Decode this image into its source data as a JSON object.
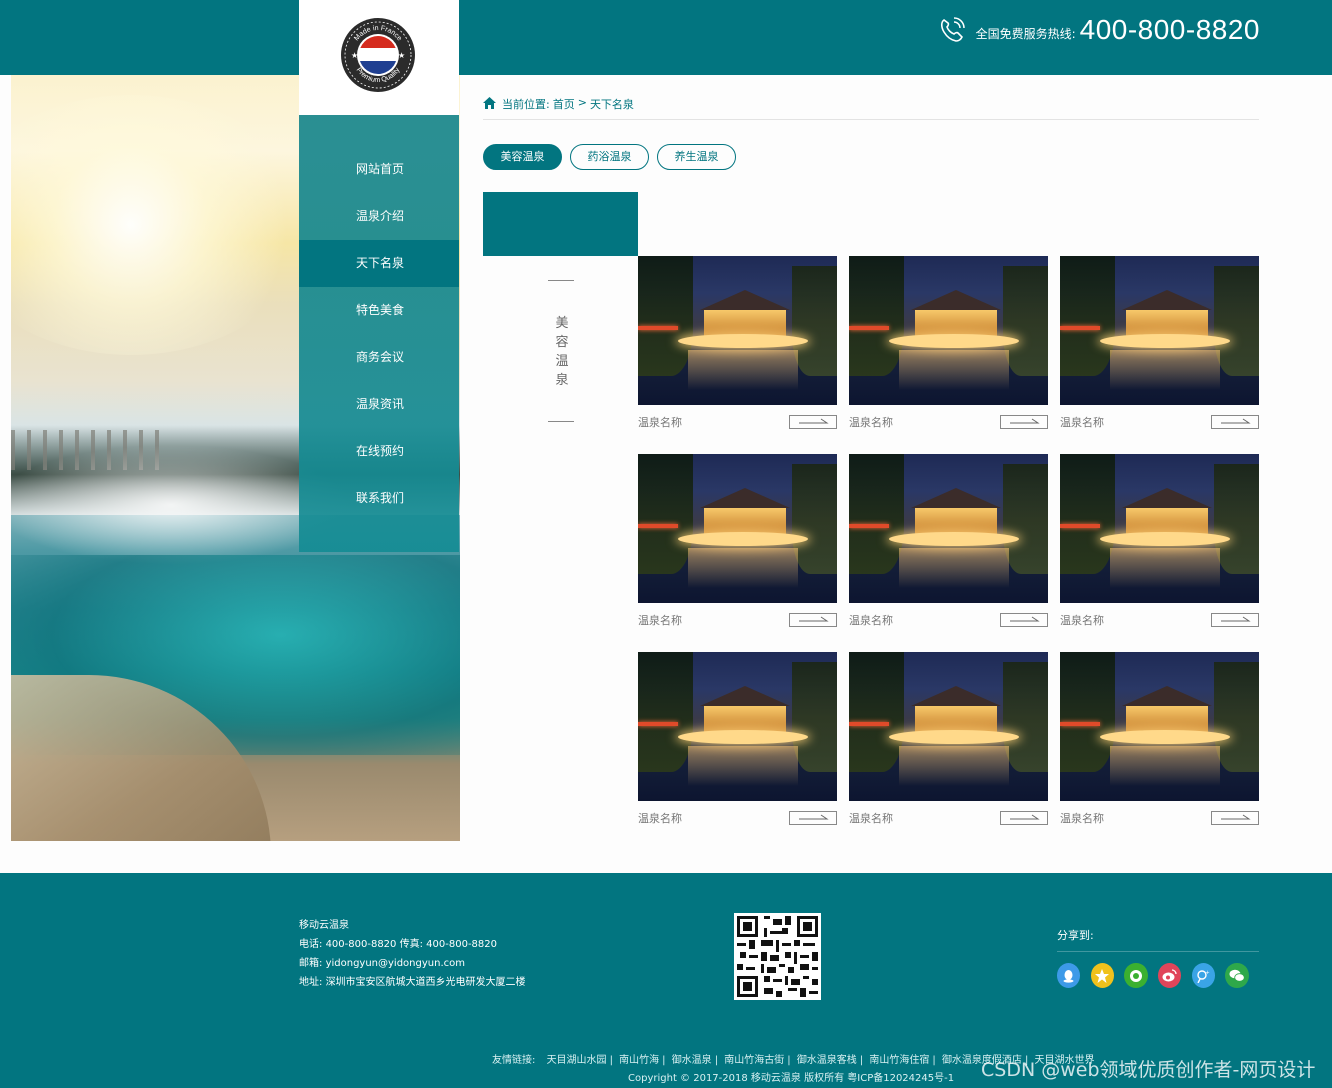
{
  "colors": {
    "brand": "#027580",
    "accent_white": "#ffffff",
    "text_gray": "#777777"
  },
  "header": {
    "hotline_label": "全国免费服务热线:",
    "hotline_number": "400-800-8820",
    "logo_badge_top": "Made in France",
    "logo_badge_bottom": "Premium Quality"
  },
  "nav": {
    "items": [
      {
        "label": "网站首页",
        "active": false
      },
      {
        "label": "温泉介绍",
        "active": false
      },
      {
        "label": "天下名泉",
        "active": true
      },
      {
        "label": "特色美食",
        "active": false
      },
      {
        "label": "商务会议",
        "active": false
      },
      {
        "label": "温泉资讯",
        "active": false
      },
      {
        "label": "在线预约",
        "active": false
      },
      {
        "label": "联系我们",
        "active": false
      }
    ]
  },
  "breadcrumb": {
    "prefix": "当前位置:",
    "home": "首页",
    "sep": ">",
    "current": "天下名泉"
  },
  "tabs": [
    {
      "label": "美容温泉",
      "active": true
    },
    {
      "label": "药浴温泉",
      "active": false
    },
    {
      "label": "养生温泉",
      "active": false
    }
  ],
  "category": {
    "chars": [
      "美",
      "容",
      "温",
      "泉"
    ]
  },
  "cards": [
    {
      "name": "温泉名称"
    },
    {
      "name": "温泉名称"
    },
    {
      "name": "温泉名称"
    },
    {
      "name": "温泉名称"
    },
    {
      "name": "温泉名称"
    },
    {
      "name": "温泉名称"
    },
    {
      "name": "温泉名称"
    },
    {
      "name": "温泉名称"
    },
    {
      "name": "温泉名称"
    }
  ],
  "footer": {
    "company": "移动云温泉",
    "tel_label": "电话:",
    "tel": "400-800-8820",
    "fax_label": "传真:",
    "fax": "400-800-8820",
    "email_label": "邮箱:",
    "email": "yidongyun@yidongyun.com",
    "addr_label": "地址:",
    "addr": "深圳市宝安区航城大道西乡光电研发大厦二楼",
    "share_title": "分享到:",
    "share_icons": [
      "qq-icon",
      "qzone-icon",
      "pengyou-icon",
      "weibo-icon",
      "tencent-weibo-icon",
      "wechat-icon"
    ],
    "links_label": "友情链接:",
    "links": [
      "天目湖山水园",
      "南山竹海",
      "御水温泉",
      "南山竹海古街",
      "御水温泉客栈",
      "南山竹海住宿",
      "御水温泉度假酒店",
      "天目湖水世界"
    ],
    "copyright": "Copyright © 2017-2018 移动云温泉 版权所有 粤ICP备12024245号-1"
  },
  "watermark": "CSDN @web领域优质创作者-网页设计"
}
